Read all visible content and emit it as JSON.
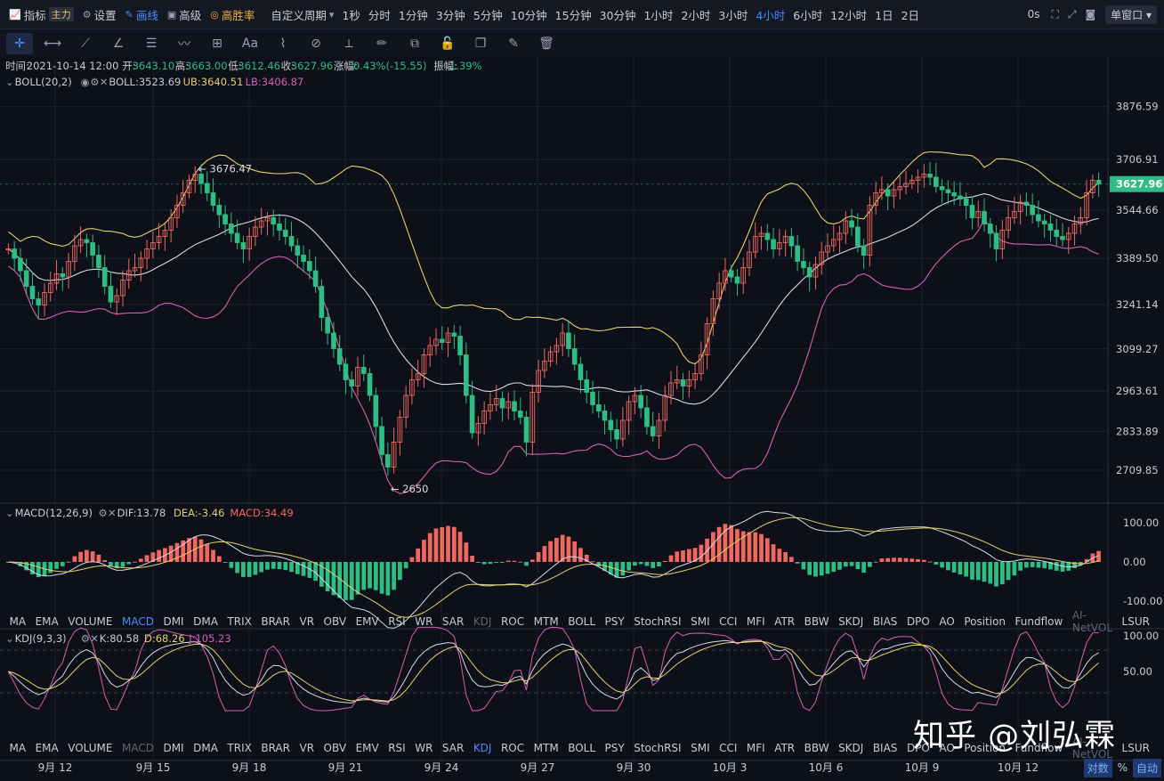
{
  "topbar": {
    "indicators": "指标",
    "indicators_tag": "主力",
    "settings": "设置",
    "draw": "画线",
    "advanced": "高级",
    "winrate": "高胜率",
    "custom_period": "自定义周期",
    "periods": [
      "1秒",
      "分时",
      "1分钟",
      "3分钟",
      "5分钟",
      "10分钟",
      "15分钟",
      "30分钟",
      "1小时",
      "2小时",
      "3小时",
      "4小时",
      "6小时",
      "12小时",
      "1日",
      "2日"
    ],
    "active_period": "4小时",
    "countdown": "0s",
    "window_mode": "单窗口"
  },
  "toolbar_icons": [
    "crosshair-icon",
    "horizontal-line-icon",
    "trend-line-icon",
    "angle-icon",
    "parallel-channel-icon",
    "wave-icon",
    "rectangle-icon",
    "text-icon",
    "brush-icon",
    "pattern-icon",
    "ruler-icon",
    "pencil-icon",
    "measure-icon",
    "lock-icon",
    "copy-icon",
    "edit-icon",
    "delete-icon"
  ],
  "info_bar": {
    "time_label": "时间:",
    "time": "2021-10-14 12:00",
    "open_label": "开:",
    "open": "3643.10",
    "high_label": "高:",
    "high": "3663.00",
    "low_label": "低:",
    "low": "3612.46",
    "close_label": "收:",
    "close": "3627.96",
    "change_label": "涨幅:",
    "change": "-0.43%(-15.55)",
    "amp_label": "振幅:",
    "amp": "1.39%"
  },
  "boll_legend": {
    "name": "BOLL(20,2)",
    "mid": "BOLL:3523.69",
    "ub": "UB:3640.51",
    "lb": "LB:3406.87"
  },
  "macd_legend": {
    "name": "MACD(12,26,9)",
    "dif": "DIF:13.78",
    "dea": "DEA:-3.46",
    "macd": "MACD:34.49"
  },
  "kdj_legend": {
    "name": "KDJ(9,3,3)",
    "k": "K:80.58",
    "d": "D:68.26",
    "j": "J:105.23"
  },
  "indicator_strip": [
    "MA",
    "EMA",
    "VOLUME",
    "MACD",
    "DMI",
    "DMA",
    "TRIX",
    "BRAR",
    "VR",
    "OBV",
    "EMV",
    "RSI",
    "WR",
    "SAR",
    "KDJ",
    "ROC",
    "MTM",
    "BOLL",
    "PSY",
    "StochRSI",
    "SMI",
    "CCI",
    "MFI",
    "ATR",
    "BBW",
    "SKDJ",
    "BIAS",
    "DPO",
    "AO",
    "Position",
    "Fundflow",
    "AI-NetVOL",
    "LSUR"
  ],
  "strip1_active": "MACD",
  "strip1_dim": [
    "KDJ",
    "AI-NetVOL"
  ],
  "strip2_active": "KDJ",
  "strip2_dim": [
    "MACD",
    "AI-NetVOL"
  ],
  "x_labels": [
    "9月 12",
    "9月 15",
    "9月 18",
    "9月 21",
    "9月 24",
    "9月 27",
    "9月 30",
    "10月 3",
    "10月 6",
    "10月 9",
    "10月 12"
  ],
  "bottom_right": {
    "log": "对数",
    "pct": "%",
    "auto": "自动"
  },
  "watermark": "知乎 @刘弘霖",
  "colors": {
    "up": "#f0675f",
    "down": "#2ebd85",
    "ub": "#e6d06a",
    "mid": "#d8dae6",
    "lb": "#d860b4",
    "bg": "#0d1018"
  },
  "chart_data": [
    {
      "type": "candlestick",
      "title": "",
      "price_axis_ticks": [
        3876.59,
        3706.91,
        3544.66,
        3389.5,
        3241.14,
        3099.27,
        2963.61,
        2833.89,
        2709.85
      ],
      "current_price": 3627.96,
      "annotations": [
        {
          "text": "← 3676.47",
          "value": 3676.47
        },
        {
          "text": "← 2650",
          "value": 2650
        }
      ],
      "x_tick_labels": [
        "9月 12",
        "9月 15",
        "9月 18",
        "9月 21",
        "9月 24",
        "9月 27",
        "9月 30",
        "10月 3",
        "10月 6",
        "10月 9",
        "10月 12"
      ],
      "close_series": [
        3420,
        3390,
        3350,
        3300,
        3260,
        3240,
        3280,
        3310,
        3340,
        3330,
        3380,
        3430,
        3450,
        3440,
        3400,
        3360,
        3300,
        3250,
        3270,
        3320,
        3350,
        3360,
        3390,
        3420,
        3440,
        3460,
        3480,
        3520,
        3560,
        3600,
        3640,
        3660,
        3630,
        3600,
        3560,
        3530,
        3500,
        3470,
        3440,
        3420,
        3460,
        3490,
        3510,
        3520,
        3500,
        3480,
        3460,
        3430,
        3400,
        3380,
        3350,
        3300,
        3200,
        3150,
        3100,
        3050,
        3000,
        2980,
        3040,
        3020,
        2950,
        2850,
        2760,
        2720,
        2800,
        2880,
        2950,
        3000,
        3020,
        3080,
        3110,
        3130,
        3120,
        3150,
        3140,
        3080,
        2950,
        2830,
        2860,
        2900,
        2920,
        2940,
        2910,
        2930,
        2900,
        2880,
        2800,
        2960,
        3030,
        3060,
        3090,
        3110,
        3150,
        3100,
        3050,
        3000,
        2960,
        2920,
        2900,
        2870,
        2840,
        2810,
        2870,
        2930,
        2950,
        2910,
        2850,
        2820,
        2870,
        2950,
        2990,
        3000,
        2980,
        3000,
        3020,
        3080,
        3180,
        3260,
        3310,
        3350,
        3330,
        3310,
        3360,
        3410,
        3460,
        3470,
        3450,
        3420,
        3440,
        3460,
        3430,
        3380,
        3360,
        3330,
        3370,
        3410,
        3430,
        3450,
        3470,
        3510,
        3490,
        3430,
        3400,
        3560,
        3600,
        3610,
        3590,
        3610,
        3620,
        3630,
        3640,
        3650,
        3660,
        3650,
        3620,
        3610,
        3600,
        3590,
        3580,
        3560,
        3520,
        3540,
        3500,
        3470,
        3420,
        3480,
        3520,
        3540,
        3570,
        3560,
        3530,
        3510,
        3500,
        3480,
        3460,
        3450,
        3470,
        3500,
        3520,
        3600,
        3640,
        3628
      ],
      "series": [
        {
          "name": "BOLL",
          "value": 3523.69
        },
        {
          "name": "UB",
          "value": 3640.51
        },
        {
          "name": "LB",
          "value": 3406.87
        }
      ],
      "ylim": [
        2650,
        3950
      ]
    },
    {
      "type": "bar",
      "title": "",
      "y_ticks": [
        100,
        0,
        -100
      ],
      "ylim": [
        -130,
        130
      ],
      "series": [
        {
          "name": "DIF",
          "value": 13.78
        },
        {
          "name": "DEA",
          "value": -3.46
        },
        {
          "name": "MACD",
          "value": 34.49
        }
      ]
    },
    {
      "type": "line",
      "title": "",
      "y_ticks": [
        100,
        50
      ],
      "ylim": [
        0,
        125
      ],
      "series": [
        {
          "name": "K",
          "value": 80.58
        },
        {
          "name": "D",
          "value": 68.26
        },
        {
          "name": "J",
          "value": 105.23
        }
      ]
    }
  ]
}
